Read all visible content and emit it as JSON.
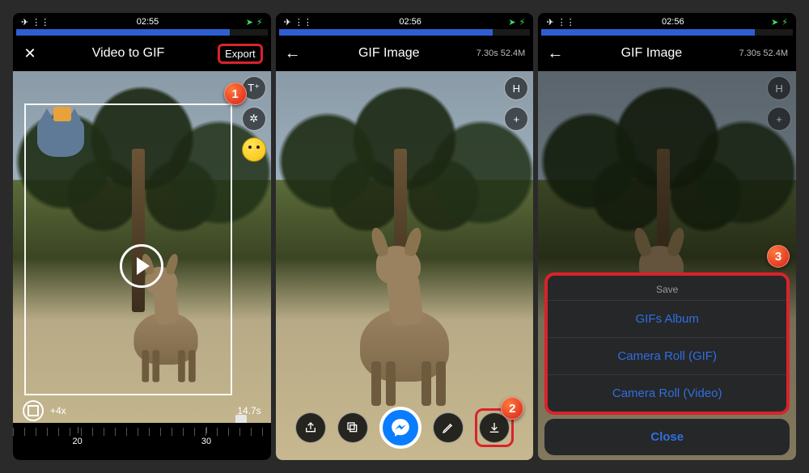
{
  "status": {
    "airplane": "✈︎",
    "wifi": "⋮⋮",
    "time1": "02:55",
    "time2": "02:56",
    "time3": "02:56",
    "nav": "➤",
    "battery": "⚡︎"
  },
  "screen1": {
    "title": "Video to GIF",
    "export": "Export",
    "speed": "+4x",
    "duration": "14.7s",
    "ticks": [
      "20",
      "30"
    ],
    "tools": {
      "text": "T⁺",
      "puzzle": "✲"
    },
    "step": "1"
  },
  "screen2": {
    "title": "GIF Image",
    "meta": "7.30s 52.4M",
    "tools": {
      "h": "H",
      "plus": "+"
    },
    "step": "2"
  },
  "screen3": {
    "title": "GIF Image",
    "meta": "7.30s 52.4M",
    "tools": {
      "h": "H",
      "plus": "+"
    },
    "sheet": {
      "header": "Save",
      "options": [
        "GIFs Album",
        "Camera Roll (GIF)",
        "Camera Roll (Video)"
      ]
    },
    "close": "Close",
    "step": "3"
  }
}
